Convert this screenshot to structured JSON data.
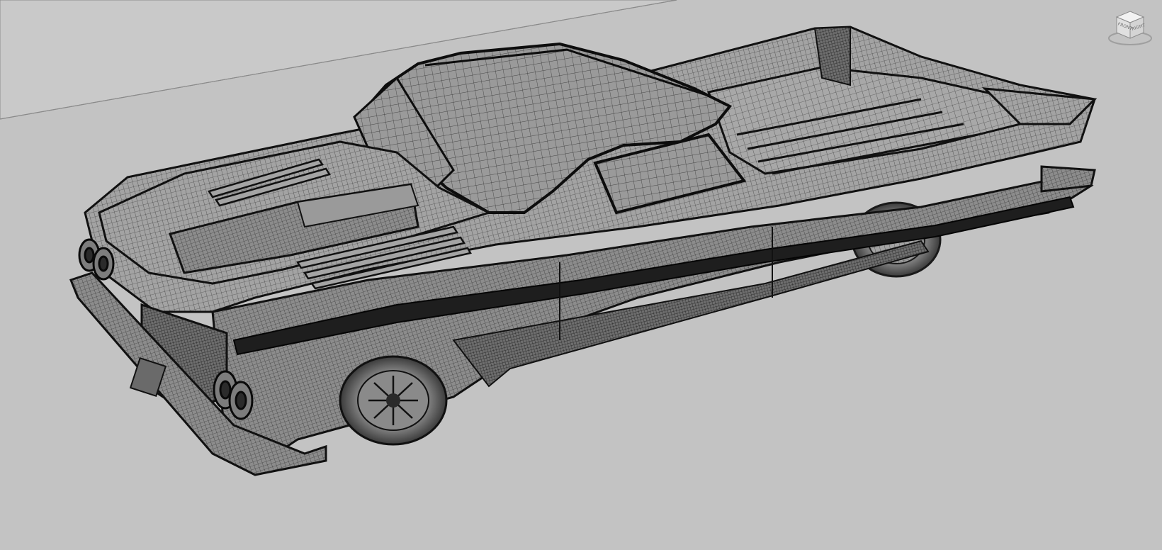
{
  "viewport": {
    "mode": "wireframe",
    "background_color": "#c3c3c3",
    "model_line_color": "#1a1a1a",
    "subject": "car-mesh"
  },
  "viewcube": {
    "face_left": "FRONT",
    "face_right": "RIGHT",
    "icon": "viewcube-icon"
  }
}
